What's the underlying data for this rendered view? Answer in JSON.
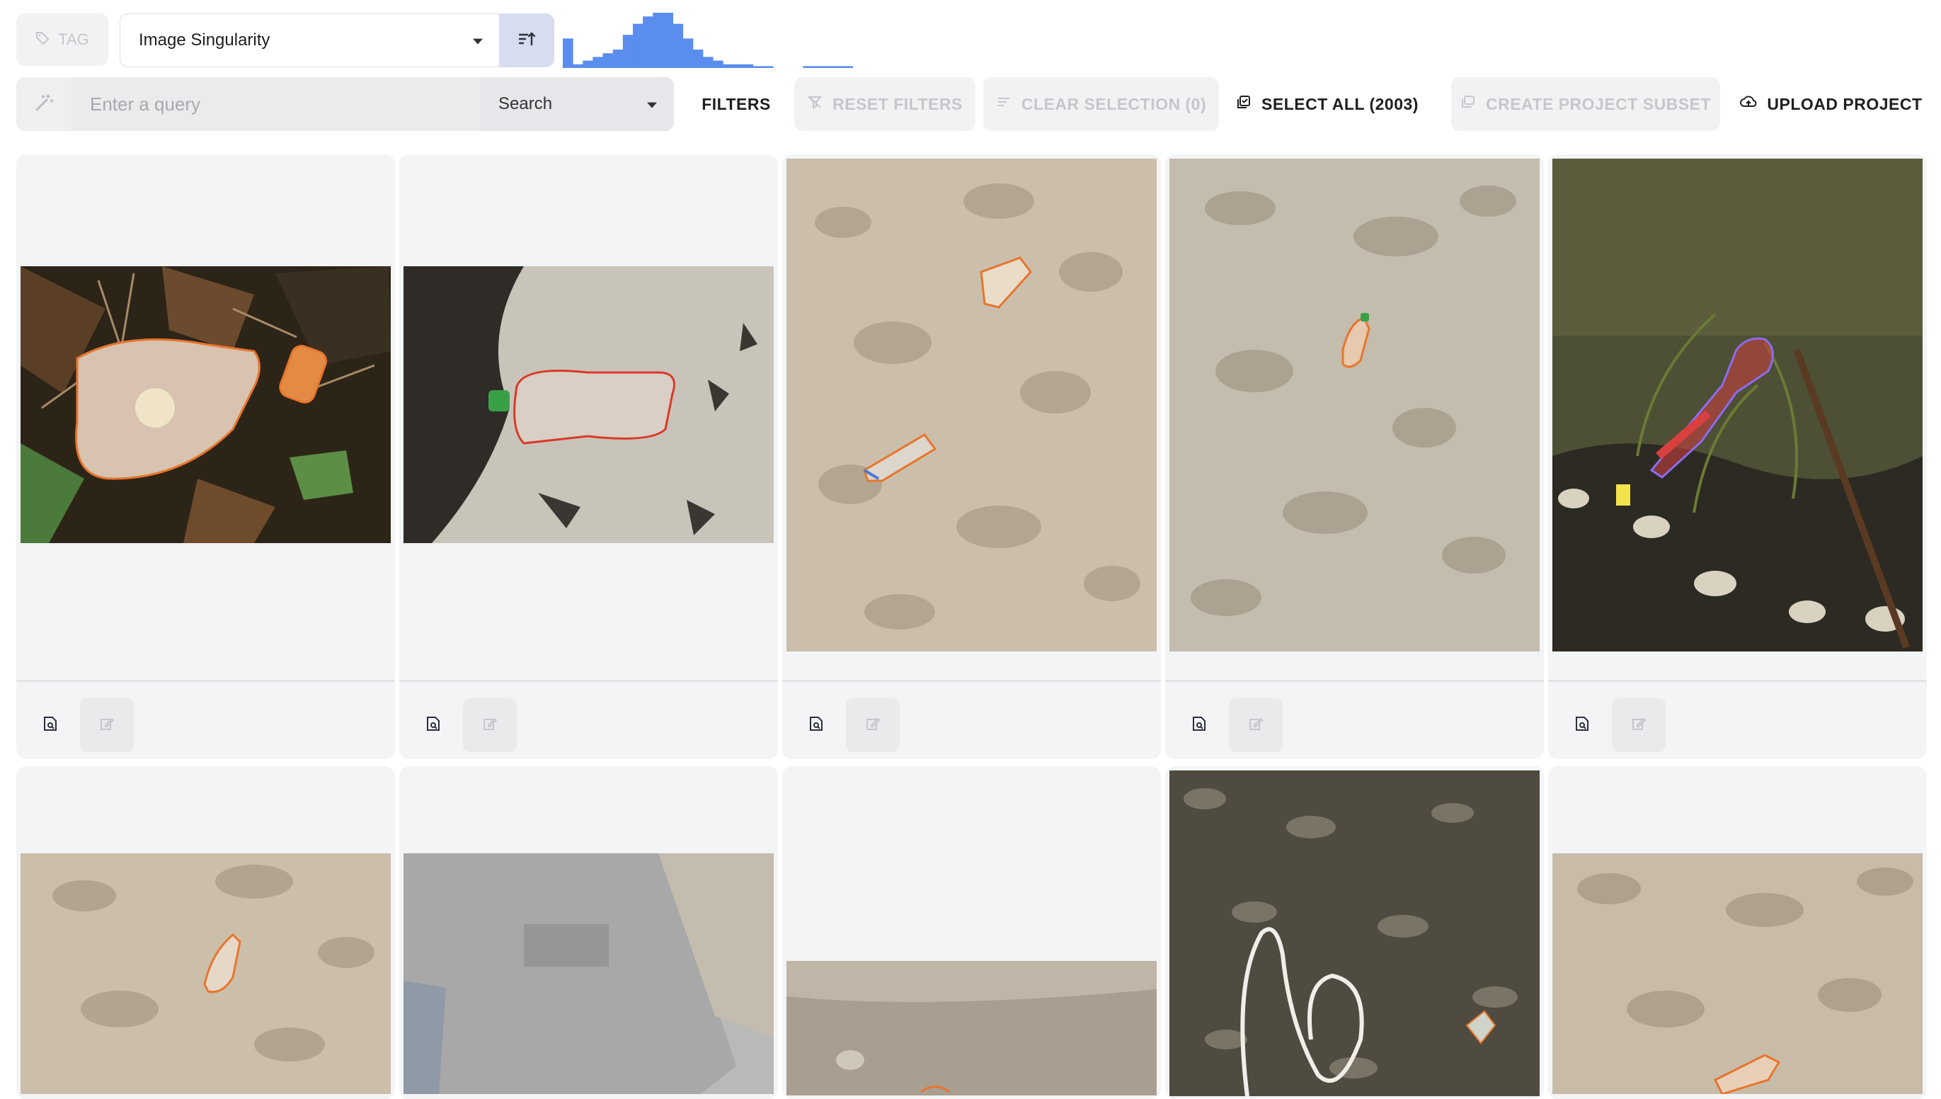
{
  "toolbar": {
    "tag_label": "TAG",
    "sort_select_value": "Image Singularity",
    "query_placeholder": "Enter a query",
    "search_mode": "Search",
    "filters_label": "FILTERS",
    "reset_filters_label": "RESET FILTERS",
    "clear_selection_label": "CLEAR SELECTION (0)",
    "select_all_label": "SELECT ALL (2003)",
    "create_subset_label": "CREATE PROJECT SUBSET",
    "upload_label": "UPLOAD PROJECT"
  },
  "histogram": {
    "color": "#5b8def",
    "bins": [
      8,
      1,
      2,
      3,
      4,
      5,
      9,
      12,
      14,
      15,
      15,
      12,
      8,
      5,
      3,
      2,
      1,
      1,
      1,
      0.5,
      0.5,
      0,
      0,
      0,
      0.5,
      0.5,
      0.5,
      0.5,
      0.5
    ]
  },
  "grid": {
    "cards": [
      {
        "scene": "bottle-leaves",
        "outline_color": "#e8752c"
      },
      {
        "scene": "bottle-sand-dark",
        "outline_color": "#d83a2a"
      },
      {
        "scene": "sand-two-bottles",
        "outline_color": "#e8752c"
      },
      {
        "scene": "sand-one-bottle",
        "outline_color": "#e8752c"
      },
      {
        "scene": "water-spoon",
        "outline_color": "#8a6cf0"
      },
      {
        "scene": "sand-bottle-2",
        "outline_color": "#e8752c"
      },
      {
        "scene": "concrete-wall",
        "outline_color": "#e8752c"
      },
      {
        "scene": "beach-flat",
        "outline_color": "#e8752c"
      },
      {
        "scene": "shells-rope",
        "outline_color": "#e8752c"
      },
      {
        "scene": "sand-bottle-3",
        "outline_color": "#e8752c"
      }
    ]
  }
}
